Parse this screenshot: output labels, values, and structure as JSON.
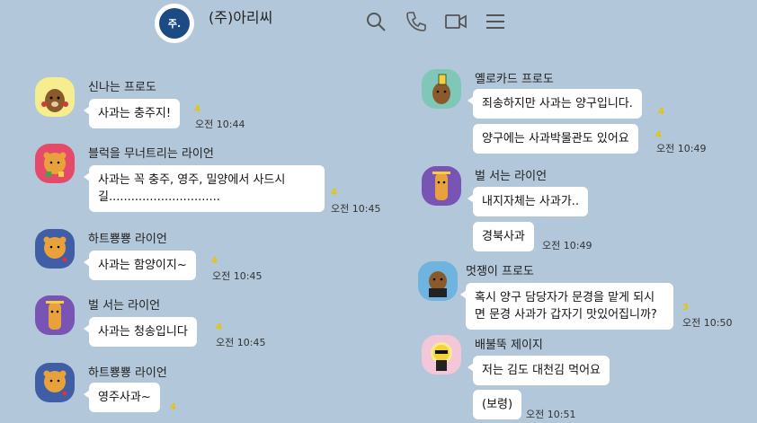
{
  "room": {
    "title": "(주)아리씨",
    "avatar_text": "주.",
    "icons": [
      "search-icon",
      "phone-icon",
      "video-icon",
      "menu-icon"
    ]
  },
  "left_messages": [
    {
      "sender": "신나는 프로도",
      "text": "사과는 충주지!",
      "unread": "4",
      "time": "오전 10:44"
    },
    {
      "sender": "블럭을 무너트리는 라이언",
      "text": "사과는 꼭 충주, 영주, 밀양에서 사드시길..............................",
      "unread": "4",
      "time": "오전 10:45"
    },
    {
      "sender": "하트뿅뿅 라이언",
      "text": "사과는 함양이지~",
      "unread": "4",
      "time": "오전 10:45"
    },
    {
      "sender": "벌 서는 라이언",
      "text": "사과는 청송입니다",
      "unread": "4",
      "time": "오전 10:45"
    },
    {
      "sender": "하트뿅뿅 라이언",
      "text": "영주사과~",
      "unread": "4",
      "time": ""
    }
  ],
  "right_messages": [
    {
      "sender": "옐로카드 프로도",
      "texts": [
        "죄송하지만 사과는 양구입니다.",
        "양구에는 사과박물관도 있어요"
      ],
      "unreads": [
        "4",
        "4"
      ],
      "time": "오전 10:49"
    },
    {
      "sender": "벌 서는 라이언",
      "texts": [
        "내지자체는 사과가..",
        "경북사과"
      ],
      "unreads": [
        "",
        ""
      ],
      "time": "오전 10:49"
    },
    {
      "sender": "멋쟁이 프로도",
      "texts": [
        "혹시 양구 담당자가 문경을 맡게 되시면 문경 사과가 갑자기 맛있어집니까?"
      ],
      "unreads": [
        "3"
      ],
      "time": "오전 10:50"
    },
    {
      "sender": "배불뚝 제이지",
      "texts": [
        "저는 김도 대천김 먹어요",
        "(보령)"
      ],
      "unreads": [
        "",
        ""
      ],
      "time": "오전 10:51"
    }
  ]
}
